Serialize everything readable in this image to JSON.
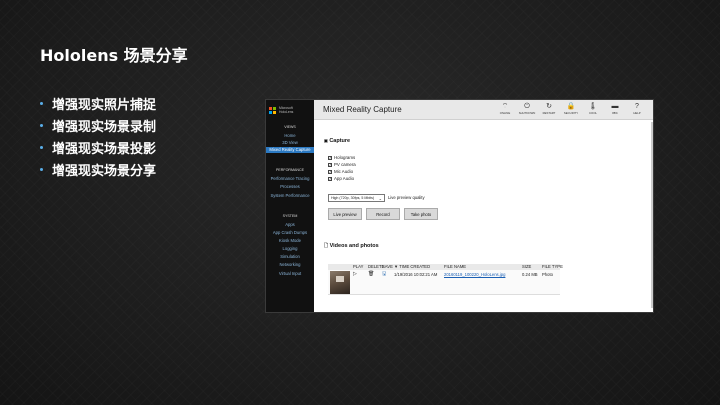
{
  "slide": {
    "title": "Hololens 场景分享",
    "bullets": [
      "增强现实照片捕捉",
      "增强现实场景录制",
      "增强现实场景投影",
      "增强现实场景分享"
    ]
  },
  "portal": {
    "logo_text": [
      "Microsoft",
      "HoloLens"
    ],
    "nav": [
      {
        "label": "VIEWS",
        "type": "head"
      },
      {
        "label": "Home",
        "type": "link"
      },
      {
        "label": "3D View",
        "type": "link"
      },
      {
        "label": "Mixed Reality Capture",
        "type": "active"
      },
      {
        "label": "PERFORMANCE",
        "type": "head"
      },
      {
        "label": "Performance Tracing",
        "type": "link"
      },
      {
        "label": "Processes",
        "type": "link"
      },
      {
        "label": "System Performance",
        "type": "link"
      },
      {
        "label": "SYSTEM",
        "type": "head"
      },
      {
        "label": "Apps",
        "type": "link"
      },
      {
        "label": "App Crash Dumps",
        "type": "link"
      },
      {
        "label": "Kiosk Mode",
        "type": "link"
      },
      {
        "label": "Logging",
        "type": "link"
      },
      {
        "label": "Simulation",
        "type": "link"
      },
      {
        "label": "Networking",
        "type": "link"
      },
      {
        "label": "Virtual Input",
        "type": "link"
      }
    ],
    "page_title": "Mixed Reality Capture",
    "toolbar": [
      {
        "icon": "wifi-icon",
        "glyph": "⌔",
        "label": "ONLINE"
      },
      {
        "icon": "power-icon",
        "glyph": "⏻",
        "label": "SHUTDOWN"
      },
      {
        "icon": "restart-icon",
        "glyph": "↻",
        "label": "RESTART"
      },
      {
        "icon": "lock-icon",
        "glyph": "🔒",
        "label": "SECURITY"
      },
      {
        "icon": "thermometer-icon",
        "glyph": "🌡",
        "label": "COOL"
      },
      {
        "icon": "battery-icon",
        "glyph": "▬",
        "label": "88%"
      },
      {
        "icon": "help-icon",
        "glyph": "?",
        "label": "HELP"
      }
    ],
    "capture": {
      "title": "Capture",
      "options": [
        {
          "label": "Holograms",
          "checked": true
        },
        {
          "label": "PV camera",
          "checked": true
        },
        {
          "label": "Mic Audio",
          "checked": true
        },
        {
          "label": "App Audio",
          "checked": true
        }
      ],
      "quality_value": "High (720p, 30fps, 5 Mbits)",
      "quality_label": "Live preview quality",
      "buttons": [
        "Live preview",
        "Record",
        "Take photo"
      ]
    },
    "videos": {
      "title": "Videos and photos",
      "columns": [
        "PLAY",
        "DELETE",
        "SAVE",
        "▼ TIME CREATED",
        "FILE NAME",
        "SIZE",
        "FILE TYPE"
      ],
      "rows": [
        {
          "time": "1/19/2016 10:02:21 AM",
          "file": "20160119_100220_HoloLens.jpg",
          "size": "0.24 MB",
          "type": "Photo"
        }
      ]
    }
  }
}
